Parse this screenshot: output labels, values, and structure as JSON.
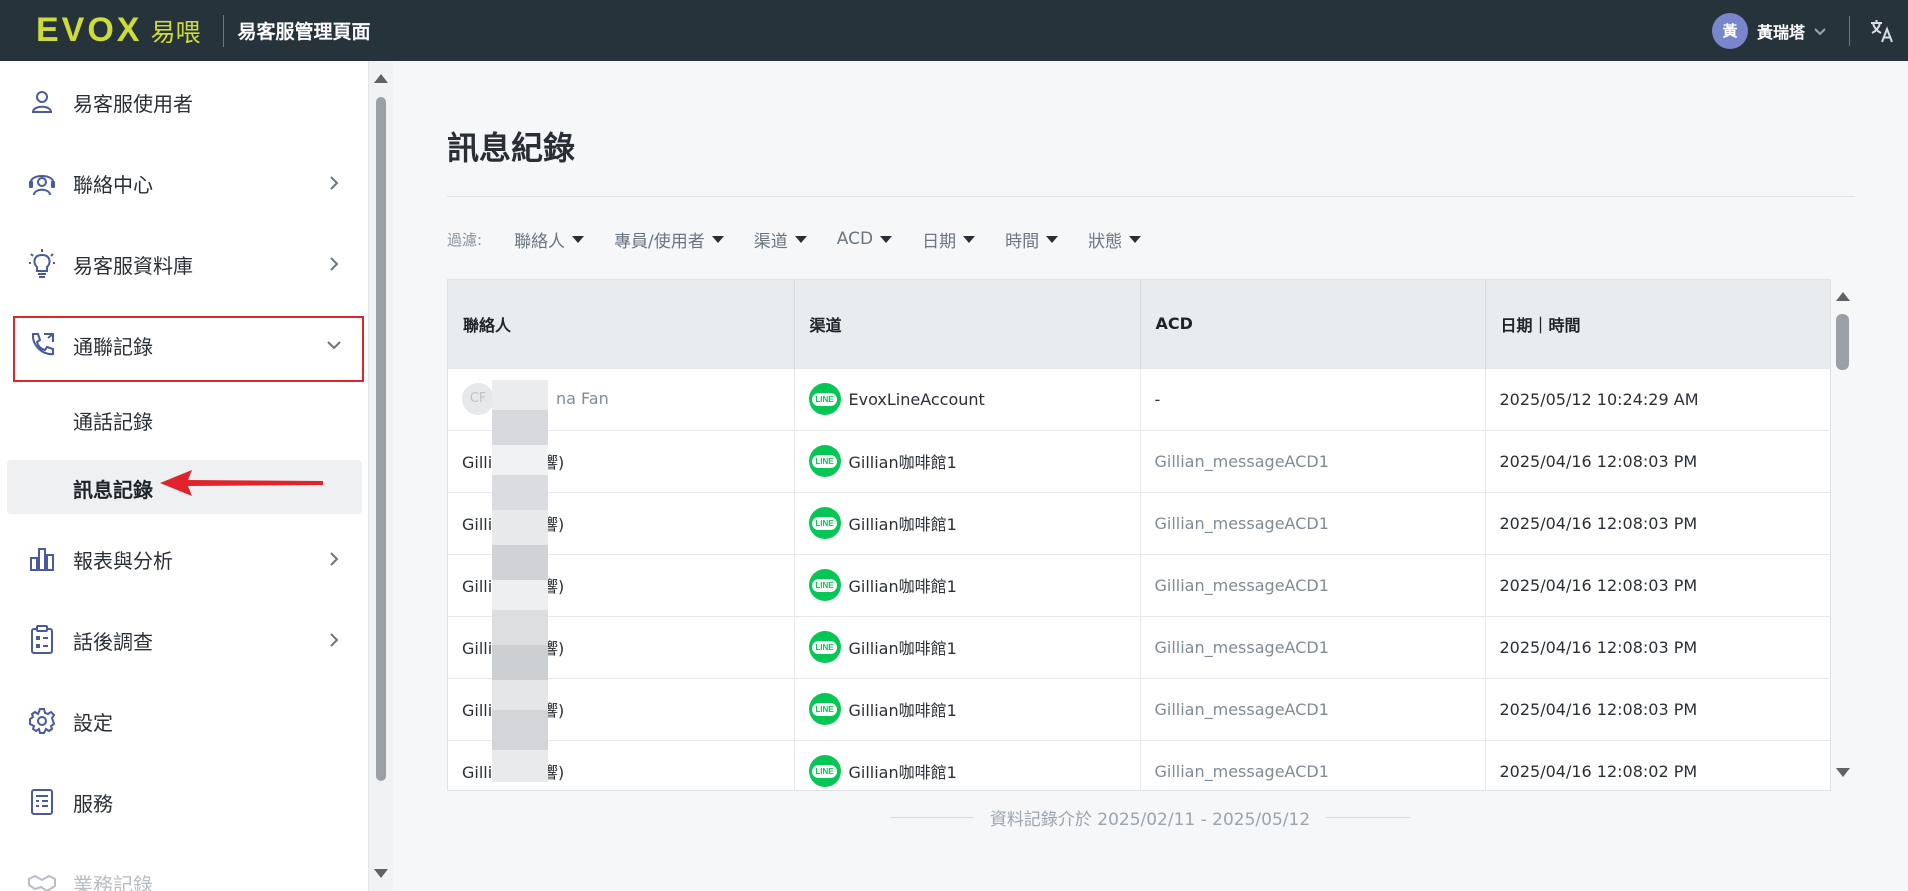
{
  "header": {
    "logo_text": "EVOX",
    "logo_cn": "易喂",
    "app_title": "易客服管理頁面",
    "user_avatar": "黃",
    "user_name": "黃瑞塔",
    "icons": [
      "chevron-down-icon",
      "translate-icon"
    ]
  },
  "sidebar": {
    "items": [
      {
        "label": "易客服使用者",
        "icon": "user-icon",
        "chevron": false
      },
      {
        "label": "聯絡中心",
        "icon": "contact-center-icon",
        "chevron": true
      },
      {
        "label": "易客服資料庫",
        "icon": "lightbulb-icon",
        "chevron": true
      },
      {
        "label": "通聯記錄",
        "icon": "phone-log-icon",
        "chevron": "down"
      },
      {
        "label": "報表與分析",
        "icon": "bar-chart-icon",
        "chevron": true
      },
      {
        "label": "話後調查",
        "icon": "clipboard-icon",
        "chevron": true
      },
      {
        "label": "設定",
        "icon": "gear-icon",
        "chevron": false
      },
      {
        "label": "服務",
        "icon": "service-icon",
        "chevron": false
      },
      {
        "label": "業務記錄",
        "icon": "handshake-icon",
        "chevron": false
      }
    ],
    "sub_items": [
      {
        "label": "通話記錄",
        "active": false
      },
      {
        "label": "訊息記錄",
        "active": true
      }
    ]
  },
  "main": {
    "title": "訊息紀錄",
    "filter_label": "過濾:",
    "filters": [
      "聯絡人",
      "專員/使用者",
      "渠道",
      "ACD",
      "日期",
      "時間",
      "狀態"
    ],
    "table": {
      "columns": [
        "聯絡人",
        "渠道",
        "ACD",
        "日期｜時間"
      ],
      "rows": [
        {
          "contact": "na Fan",
          "contact_prefix": "CF",
          "channel": "EvoxLineAccount",
          "acd": "-",
          "datetime": "2025/05/12 10:24:29 AM"
        },
        {
          "contact": "Gillia",
          "contact_suffix": "響)",
          "channel": "Gillian咖啡館1",
          "acd": "Gillian_messageACD1",
          "datetime": "2025/04/16 12:08:03 PM"
        },
        {
          "contact": "Gillia",
          "contact_suffix": "響)",
          "channel": "Gillian咖啡館1",
          "acd": "Gillian_messageACD1",
          "datetime": "2025/04/16 12:08:03 PM"
        },
        {
          "contact": "Gillia",
          "contact_suffix": "響)",
          "channel": "Gillian咖啡館1",
          "acd": "Gillian_messageACD1",
          "datetime": "2025/04/16 12:08:03 PM"
        },
        {
          "contact": "Gillia",
          "contact_suffix": "響)",
          "channel": "Gillian咖啡館1",
          "acd": "Gillian_messageACD1",
          "datetime": "2025/04/16 12:08:03 PM"
        },
        {
          "contact": "Gillia",
          "contact_suffix": "響)",
          "channel": "Gillian咖啡館1",
          "acd": "Gillian_messageACD1",
          "datetime": "2025/04/16 12:08:03 PM"
        },
        {
          "contact": "Gillia",
          "contact_suffix": "響)",
          "channel": "Gillian咖啡館1",
          "acd": "Gillian_messageACD1",
          "datetime": "2025/04/16 12:08:02 PM"
        }
      ],
      "channel_badge": "LINE"
    },
    "footer_note": "資料記錄介於 2025/02/11 - 2025/05/12"
  },
  "colors": {
    "topbar": "#27333b",
    "logo": "#cddc39",
    "avatar": "#7986cb",
    "line_green": "#06c755",
    "highlight_red": "#e0242c",
    "nav_icon": "#4a5a9a"
  }
}
